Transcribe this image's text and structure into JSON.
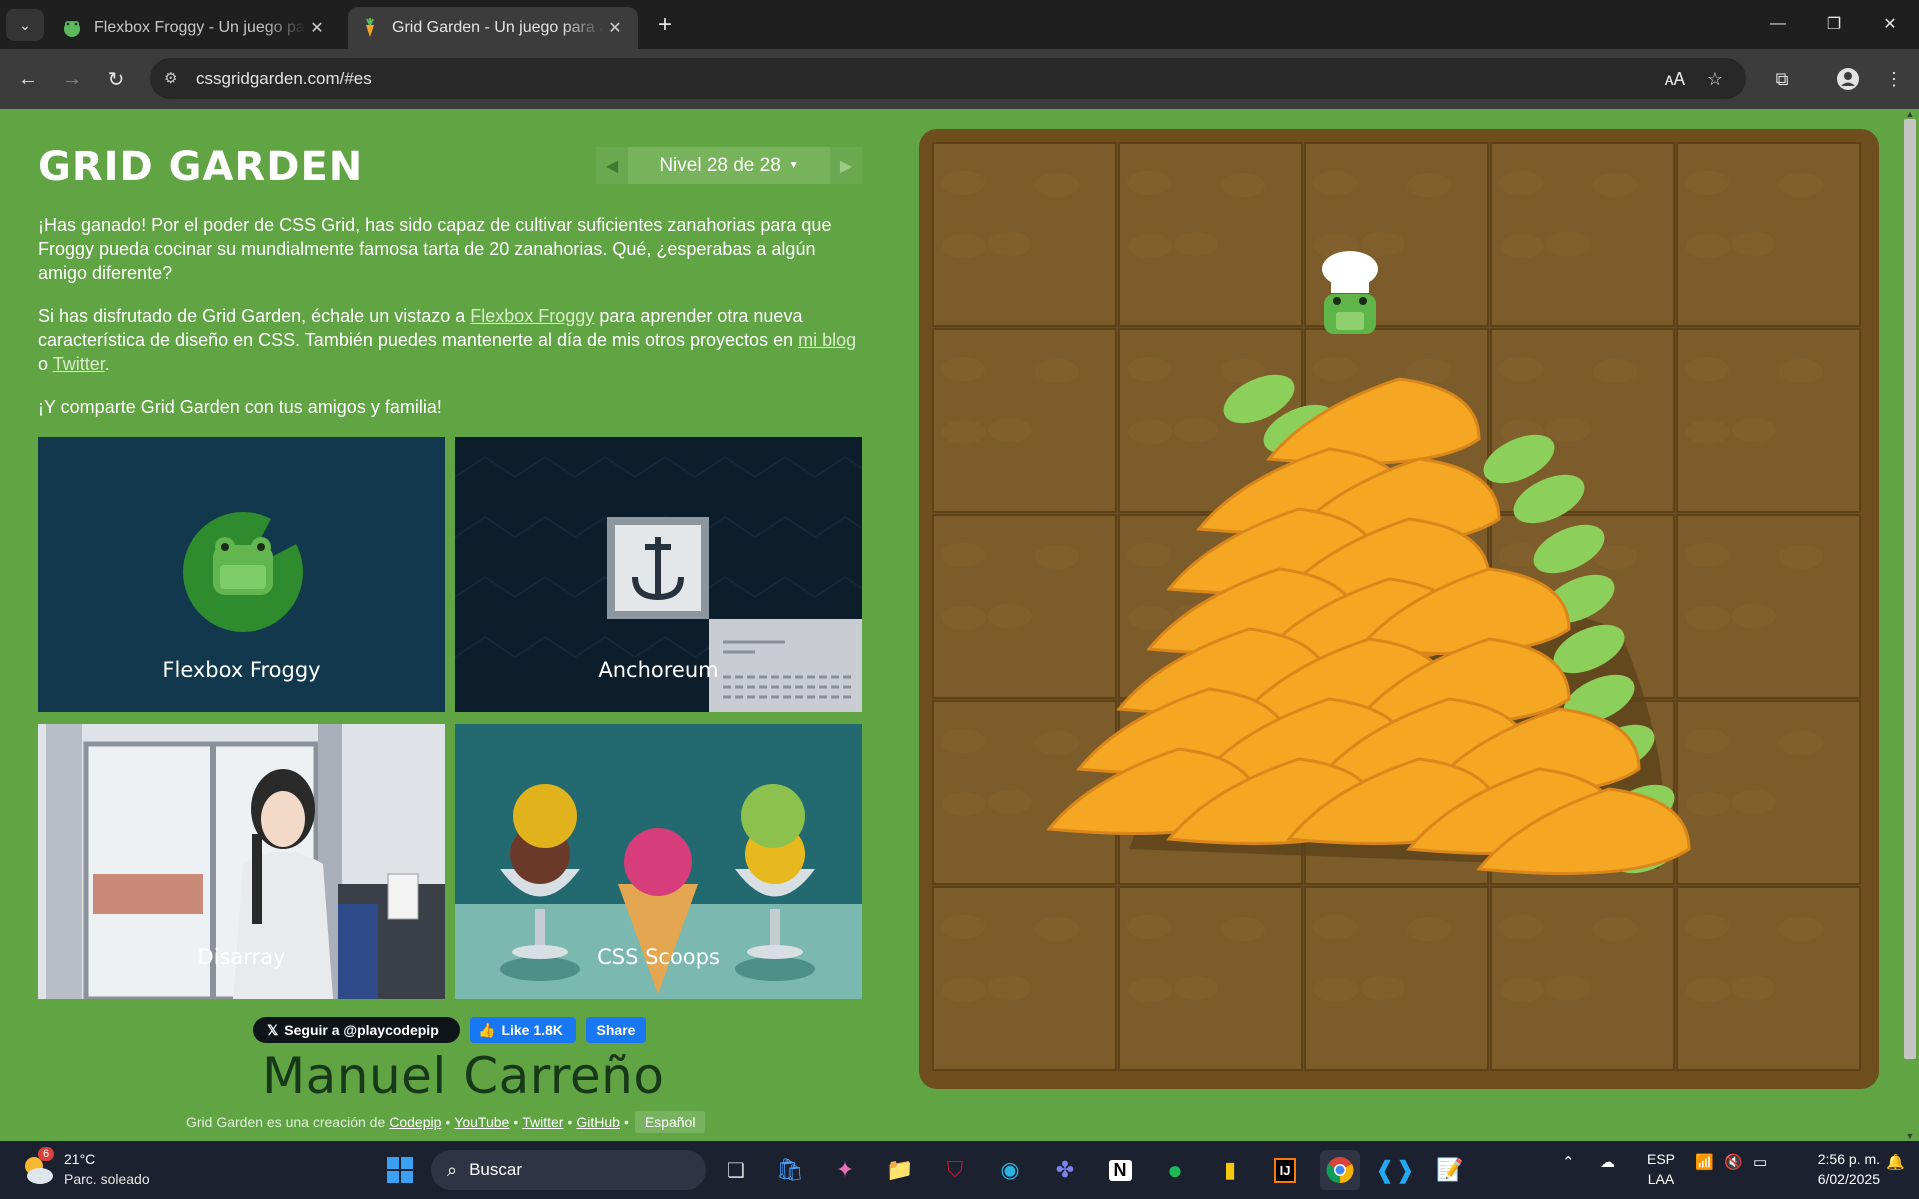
{
  "browser": {
    "tabs": [
      {
        "title": "Flexbox Froggy - Un juego para aprender CSS flexbox",
        "active": false
      },
      {
        "title": "Grid Garden - Un juego para aprender CSS grid",
        "active": true
      }
    ],
    "url": "cssgridgarden.com/#es"
  },
  "page": {
    "title": "GRID GARDEN",
    "level_label": "Nivel 28 de 28",
    "win_text": "¡Has ganado! Por el poder de CSS Grid, has sido capaz de cultivar suficientes zanahorias para que Froggy pueda cocinar su mundialmente famosa tarta de 20 zanahorias. Qué, ¿esperabas a algún amigo diferente?",
    "promo_before": "Si has disfrutado de Grid Garden, échale un vistazo a ",
    "promo_link_froggy": "Flexbox Froggy",
    "promo_middle": " para aprender otra nueva característica de diseño en CSS. También puedes mantenerte al día de mis otros proyectos en ",
    "promo_link_blog": "mi blog",
    "promo_or": " o ",
    "promo_link_twitter": "Twitter",
    "promo_end": ".",
    "share_text": "¡Y comparte Grid Garden con tus amigos y familia!",
    "cards": [
      {
        "label": "Flexbox Froggy"
      },
      {
        "label": "Anchoreum"
      },
      {
        "label": "Disarray"
      },
      {
        "label": "CSS Scoops"
      }
    ],
    "social": {
      "x_follow": "Seguir a @playcodepip",
      "fb_like": "Like 1.8K",
      "fb_share": "Share"
    },
    "signature": "Manuel Carreño",
    "credits": {
      "prefix": "Grid Garden es una creación de",
      "links": [
        "Codepip",
        "YouTube",
        "Twitter",
        "GitHub"
      ],
      "separator": "•",
      "language": "Español"
    }
  },
  "taskbar": {
    "weather_badge": "6",
    "temperature": "21°C",
    "condition": "Parc. soleado",
    "search_placeholder": "Buscar",
    "lang_top": "ESP",
    "lang_bottom": "LAA",
    "time": "2:56 p. m.",
    "date": "6/02/2025"
  },
  "colors": {
    "page_bg": "#60a444",
    "garden_soil": "#7c5c2a",
    "carrot": "#f5a623",
    "chrome_dark": "#1f1f1f"
  }
}
